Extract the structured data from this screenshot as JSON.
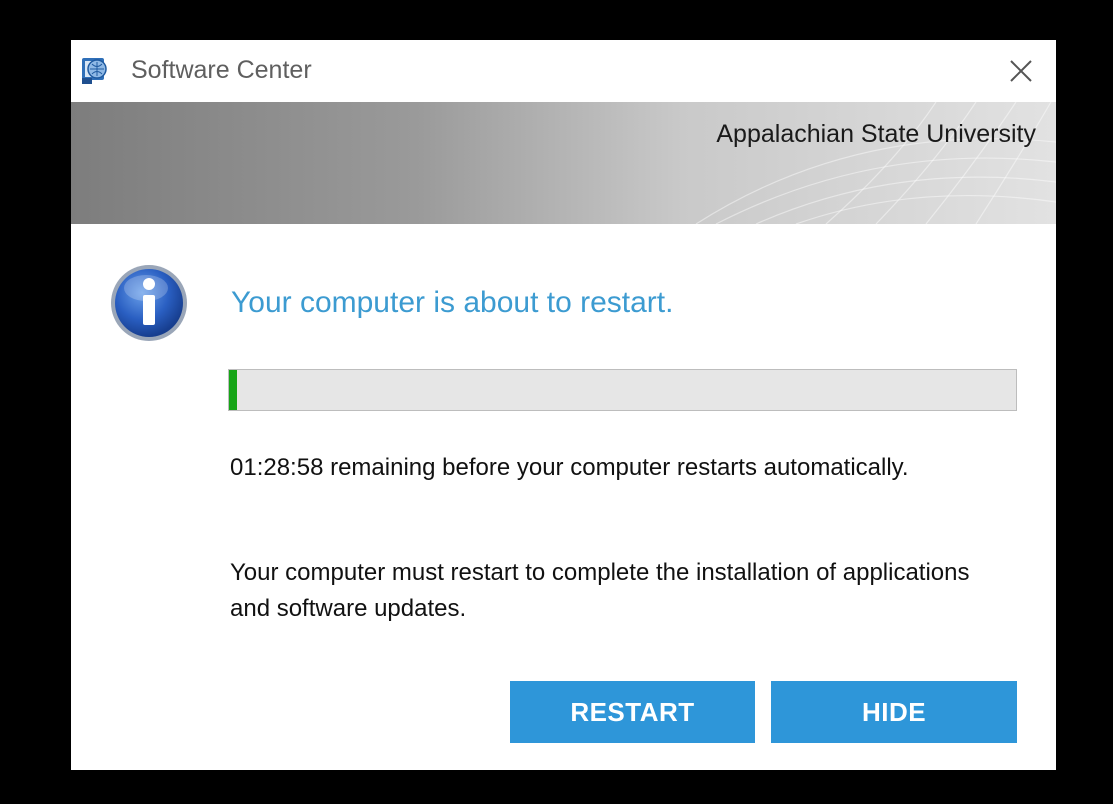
{
  "window": {
    "title": "Software Center",
    "close_icon": "close-icon",
    "app_icon": "software-center-icon"
  },
  "banner": {
    "organization": "Appalachian State University"
  },
  "notice": {
    "icon": "info-icon",
    "headline": "Your computer is about to restart.",
    "progress_fraction": 0.01,
    "countdown_message": "01:28:58 remaining before your computer restarts automatically.",
    "reason_message": "Your computer must restart to complete the installation of applications and software updates."
  },
  "buttons": {
    "restart_label": "RESTART",
    "hide_label": "HIDE"
  },
  "colors": {
    "accent": "#2e96d9",
    "headline": "#3c9bd1",
    "progress": "#16a517",
    "background": "#000000"
  }
}
